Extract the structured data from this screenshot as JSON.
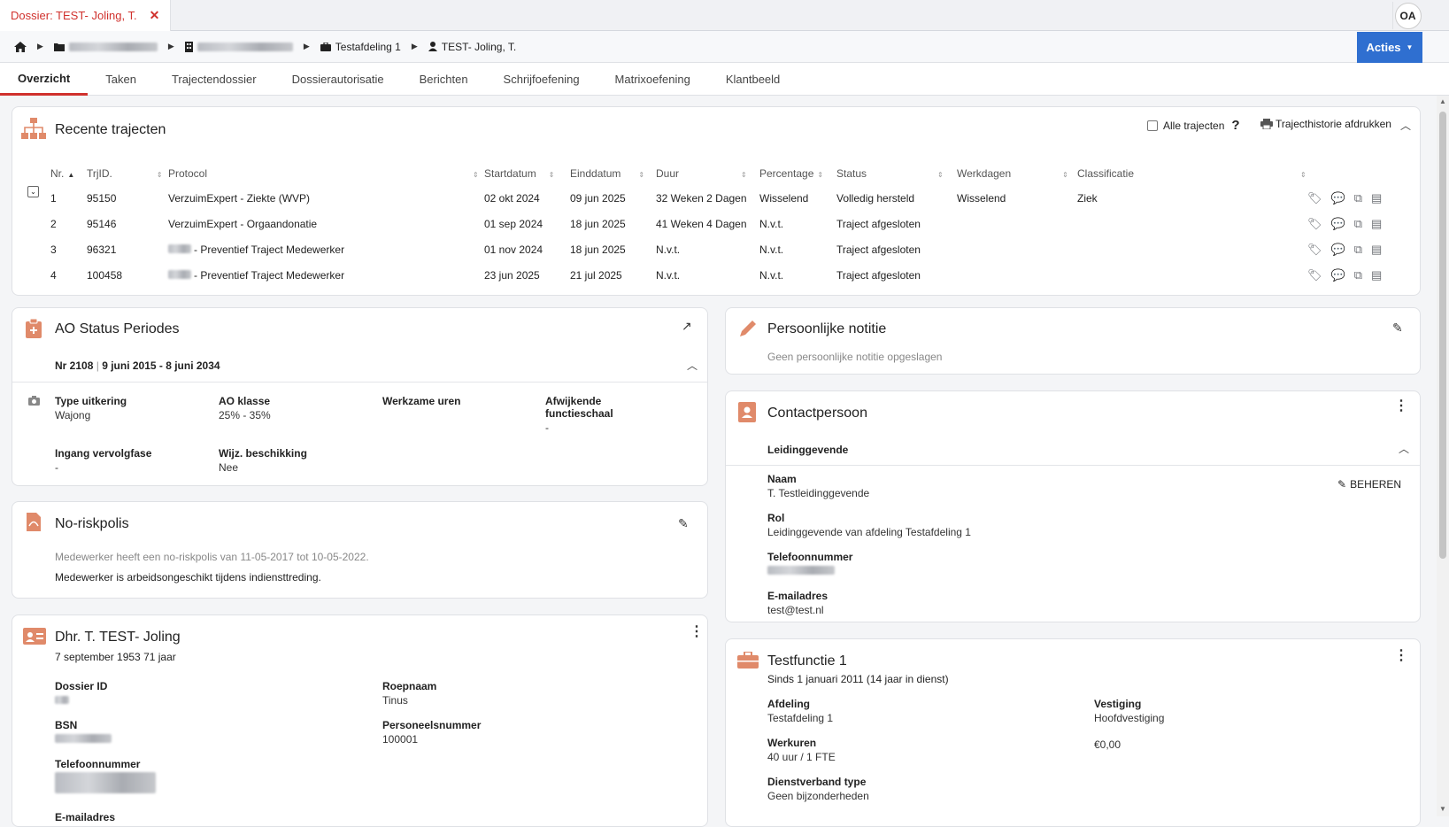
{
  "window": {
    "doc_tab_label": "Dossier: TEST- Joling, T.",
    "close_glyph": "✕",
    "avatar_initials": "OA"
  },
  "breadcrumb": {
    "department": "Testafdeling 1",
    "person": "TEST- Joling, T."
  },
  "actions_label": "Acties",
  "tabs": [
    "Overzicht",
    "Taken",
    "Trajectendossier",
    "Dossierautorisatie",
    "Berichten",
    "Schrijfoefening",
    "Matrixoefening",
    "Klantbeeld"
  ],
  "recent": {
    "title": "Recente trajecten",
    "all_label": "Alle trajecten",
    "print_label": "Trajecthistorie afdrukken",
    "columns": [
      "Nr.",
      "TrjID.",
      "Protocol",
      "Startdatum",
      "Einddatum",
      "Duur",
      "Percentage",
      "Status",
      "Werkdagen",
      "Classificatie"
    ],
    "rows": [
      {
        "nr": "1",
        "id": "95150",
        "protocol": "VerzuimExpert - Ziekte (WVP)",
        "start": "02 okt 2024",
        "end": "09 jun 2025",
        "duur": "32 Weken 2 Dagen",
        "pct": "Wisselend",
        "status": "Volledig hersteld",
        "werkdagen": "Wisselend",
        "klass": "Ziek"
      },
      {
        "nr": "2",
        "id": "95146",
        "protocol": "VerzuimExpert - Orgaandonatie",
        "start": "01 sep 2024",
        "end": "18 jun 2025",
        "duur": "41 Weken 4 Dagen",
        "pct": "N.v.t.",
        "status": "Traject afgesloten",
        "werkdagen": "",
        "klass": ""
      },
      {
        "nr": "3",
        "id": "96321",
        "protocol": "- Preventief Traject Medewerker",
        "start": "01 nov 2024",
        "end": "18 jun 2025",
        "duur": "N.v.t.",
        "pct": "N.v.t.",
        "status": "Traject afgesloten",
        "werkdagen": "",
        "klass": ""
      },
      {
        "nr": "4",
        "id": "100458",
        "protocol": "- Preventief Traject Medewerker",
        "start": "23 jun 2025",
        "end": "21 jul 2025",
        "duur": "N.v.t.",
        "pct": "N.v.t.",
        "status": "Traject afgesloten",
        "werkdagen": "",
        "klass": ""
      }
    ]
  },
  "ao": {
    "title": "AO Status Periodes",
    "period_nr": "Nr 2108",
    "period_sep": "|",
    "period_range": "9 juni 2015 - 8 juni 2034",
    "type_label": "Type uitkering",
    "type_value": "Wajong",
    "klasse_label": "AO klasse",
    "klasse_value": "25% - 35%",
    "uren_label": "Werkzame uren",
    "schaal_label": "Afwijkende functieschaal",
    "schaal_value": "-",
    "ingang_label": "Ingang vervolgfase",
    "ingang_value": "-",
    "beschikking_label": "Wijz. beschikking",
    "beschikking_value": "Nee"
  },
  "noriskpolis": {
    "title": "No-riskpolis",
    "line1": "Medewerker heeft een no-riskpolis van 11-05-2017 tot 10-05-2022.",
    "line2": "Medewerker is arbeidsongeschikt tijdens indiensttreding."
  },
  "person": {
    "title": "Dhr. T. TEST- Joling",
    "subtitle": "7 september 1953 71 jaar",
    "dossier_label": "Dossier ID",
    "roepnaam_label": "Roepnaam",
    "roepnaam_value": "Tinus",
    "bsn_label": "BSN",
    "personeel_label": "Personeelsnummer",
    "personeel_value": "100001",
    "telefoon_label": "Telefoonnummer",
    "email_label": "E-mailadres"
  },
  "notitie": {
    "title": "Persoonlijke notitie",
    "empty": "Geen persoonlijke notitie opgeslagen"
  },
  "contact": {
    "title": "Contactpersoon",
    "section": "Leidinggevende",
    "beheren": "BEHEREN",
    "naam_label": "Naam",
    "naam_value": "T. Testleidinggevende",
    "rol_label": "Rol",
    "rol_value": "Leidinggevende van afdeling Testafdeling 1",
    "tel_label": "Telefoonnummer",
    "email_label": "E-mailadres",
    "email_value": "test@test.nl"
  },
  "functie": {
    "title": "Testfunctie 1",
    "subtitle": "Sinds 1 januari 2011 (14 jaar in dienst)",
    "afdeling_label": "Afdeling",
    "afdeling_value": "Testafdeling 1",
    "vestiging_label": "Vestiging",
    "vestiging_value": "Hoofdvestiging",
    "werkuren_label": "Werkuren",
    "werkuren_value": "40 uur / 1 FTE",
    "salaris_value": "€0,00",
    "dienst_label": "Dienstverband type",
    "dienst_value": "Geen bijzonderheden"
  }
}
